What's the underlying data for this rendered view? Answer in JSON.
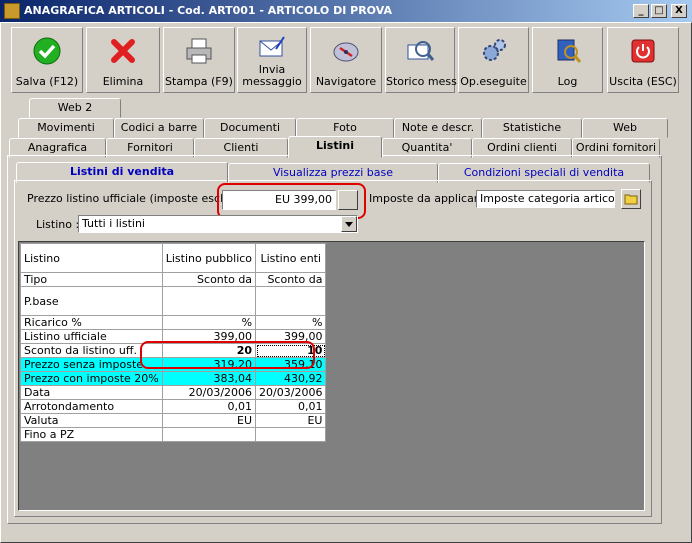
{
  "window": {
    "title": "ANAGRAFICA ARTICOLI - Cod. ART001 - ARTICOLO DI PROVA",
    "min_glyph": "_",
    "max_glyph": "□",
    "close_glyph": "X"
  },
  "toolbar": {
    "save": "Salva (F12)",
    "delete": "Elimina",
    "print": "Stampa (F9)",
    "send_line1": "Invia",
    "send_line2": "messaggio",
    "navigator": "Navigatore",
    "history": "Storico mess.",
    "ops": "Op.eseguite",
    "log": "Log",
    "exit": "Uscita (ESC)"
  },
  "tabs": {
    "row1": [
      "Web 2"
    ],
    "row2": [
      "Movimenti",
      "Codici a barre",
      "Documenti",
      "Foto",
      "Note e descr.",
      "Statistiche",
      "Web"
    ],
    "row3": [
      "Anagrafica",
      "Fornitori",
      "Clienti",
      "Listini",
      "Quantita'",
      "Ordini clienti",
      "Ordini fornitori"
    ],
    "active": "Listini"
  },
  "subtabs": {
    "items": [
      "Listini di vendita",
      "Visualizza prezzi base",
      "Condizioni speciali di vendita"
    ],
    "active": "Listini di vendita"
  },
  "form": {
    "price_label": "Prezzo listino ufficiale (imposte escluse) :",
    "price_value": "EU 399,00",
    "tax_label": "Imposte da applicare :",
    "tax_value": "Imposte categoria articolo",
    "listino_label": "Listino :",
    "listino_value": "Tutti i listini"
  },
  "grid": {
    "headers": [
      "Listino",
      "Listino pubblico",
      "Listino enti"
    ],
    "rows": [
      {
        "label": "Tipo",
        "c1": "Sconto da",
        "c2": "Sconto da"
      },
      {
        "label": "P.base",
        "c1": "",
        "c2": ""
      },
      {
        "label": "Ricarico %",
        "c1": "%",
        "c2": "%"
      },
      {
        "label": "Listino ufficiale",
        "c1": "399,00",
        "c2": "399,00"
      },
      {
        "label": "Sconto da listino uff.",
        "c1": "20",
        "c2": "10"
      },
      {
        "label": "Prezzo senza imposte",
        "c1": "319,20",
        "c2": "359,10"
      },
      {
        "label": "Prezzo con imposte 20%",
        "c1": "383,04",
        "c2": "430,92"
      },
      {
        "label": "Data",
        "c1": "20/03/2006",
        "c2": "20/03/2006"
      },
      {
        "label": "Arrotondamento",
        "c1": "0,01",
        "c2": "0,01"
      },
      {
        "label": "Valuta",
        "c1": "EU",
        "c2": "EU"
      },
      {
        "label": "Fino a PZ",
        "c1": "",
        "c2": ""
      }
    ]
  },
  "colors": {
    "highlight_cyan": "#00ffff",
    "annotation_red": "#e00000",
    "tab_text_blue": "#0000c0"
  }
}
